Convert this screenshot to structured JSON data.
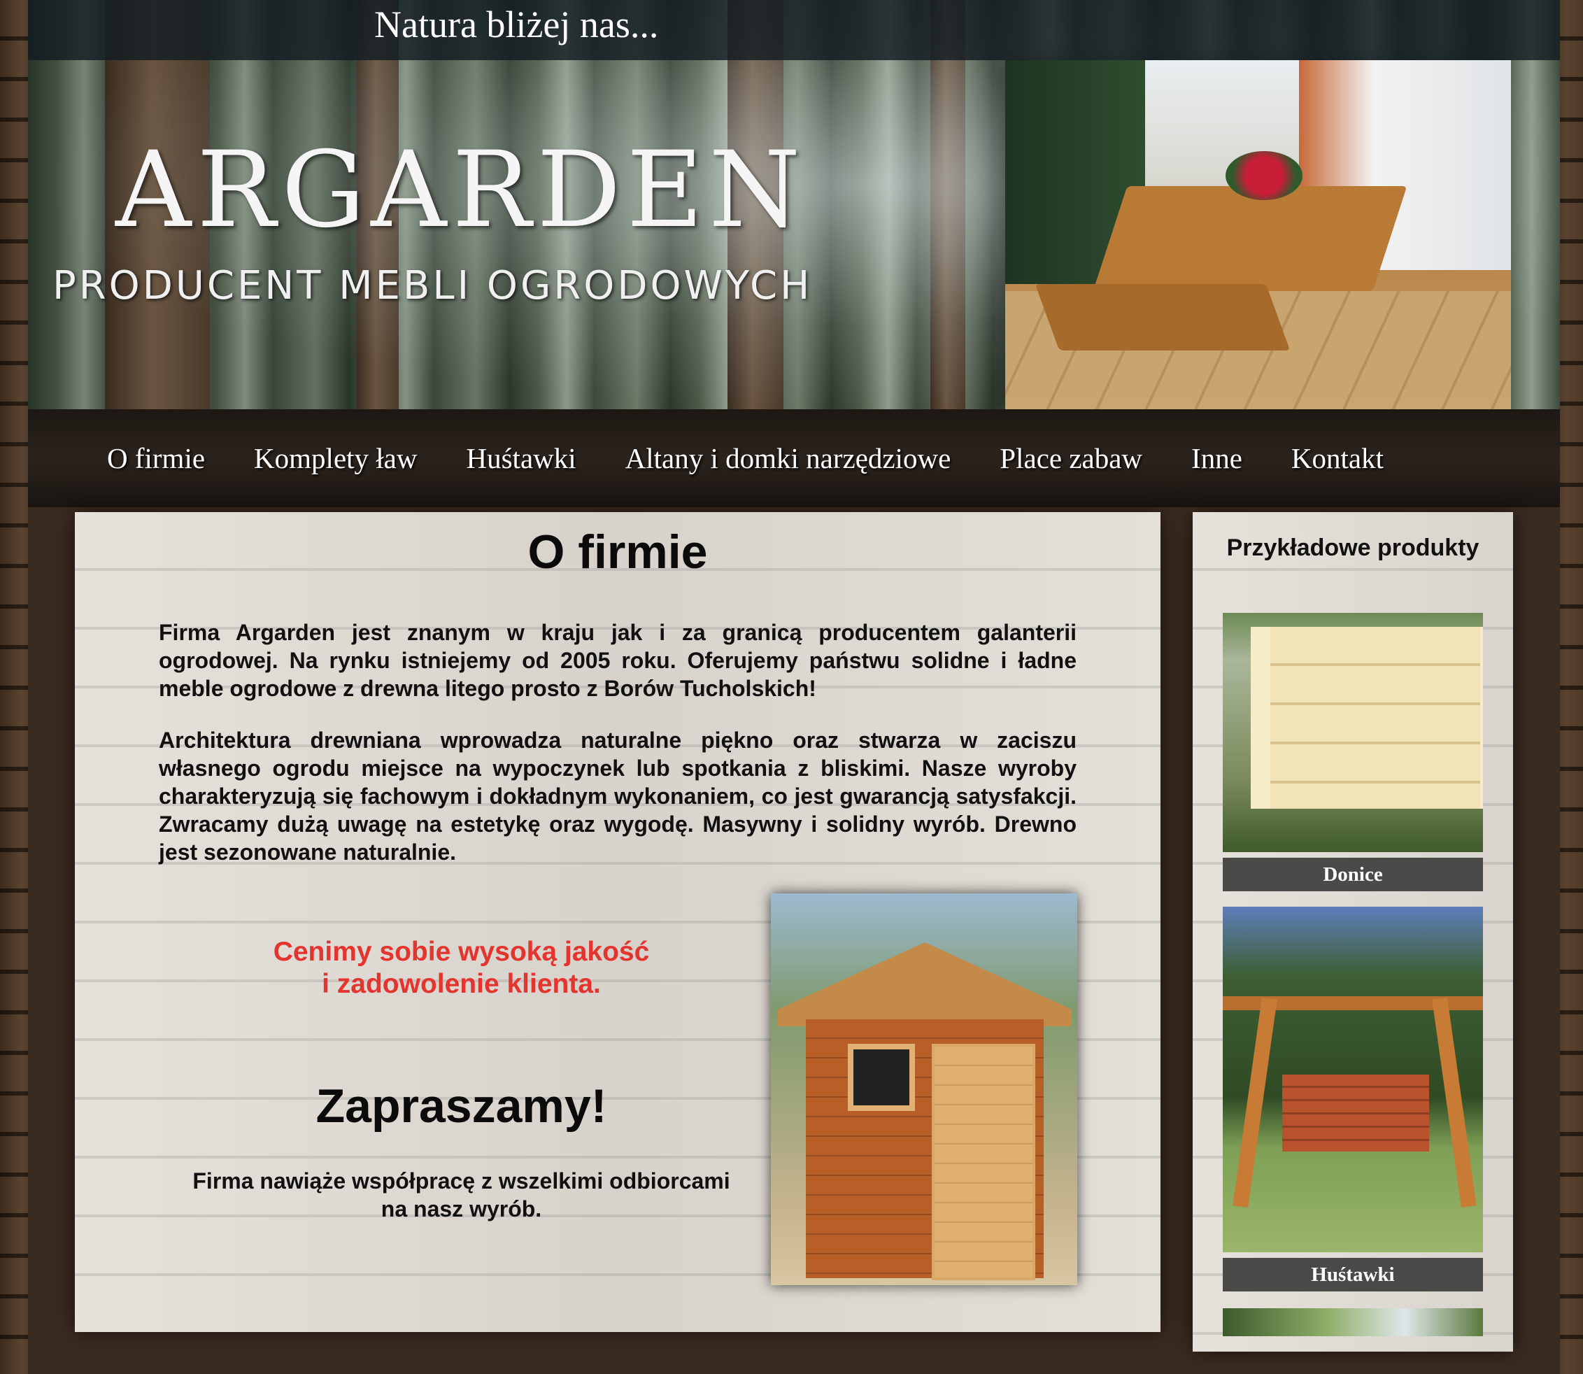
{
  "header": {
    "tagline": "Natura bliżej nas...",
    "logo": "ARGARDEN",
    "logo_subtitle": "PRODUCENT MEBLI OGRODOWYCH"
  },
  "nav": {
    "items": [
      {
        "label": "O firmie"
      },
      {
        "label": "Komplety ław"
      },
      {
        "label": "Huśtawki"
      },
      {
        "label": "Altany i domki narzędziowe"
      },
      {
        "label": "Place zabaw"
      },
      {
        "label": "Inne"
      },
      {
        "label": "Kontakt"
      }
    ]
  },
  "main": {
    "title": "O firmie",
    "paragraph1": "Firma Argarden jest znanym w kraju jak i za granicą producentem galanterii ogrodowej. Na rynku istniejemy od 2005 roku. Oferujemy państwu solidne i ładne meble ogrodowe z drewna litego prosto z Borów Tucholskich!",
    "paragraph2": "Architektura drewniana wprowadza naturalne piękno oraz stwarza w zaciszu własnego ogrodu miejsce na wypoczynek lub spotkania z bliskimi. Nasze wyroby charakteryzują się fachowym i dokładnym wykonaniem, co jest gwarancją satysfakcji. Zwracamy dużą uwagę na estetykę oraz wygodę. Masywny i solidny wyrób. Drewno jest sezonowane naturalnie.",
    "quote_line1": "Cenimy sobie wysoką jakość",
    "quote_line2": "i zadowolenie klienta.",
    "invite": "Zapraszamy!",
    "coop_line1": "Firma nawiąże współpracę z wszelkimi odbiorcami",
    "coop_line2": "na nasz wyrób."
  },
  "sidebar": {
    "title": "Przykładowe produkty",
    "products": [
      {
        "caption": "Donice"
      },
      {
        "caption": "Huśtawki"
      }
    ]
  },
  "colors": {
    "accent_red": "#e3342e",
    "nav_bg": "#231d18",
    "caption_bg": "#4a4a49"
  }
}
